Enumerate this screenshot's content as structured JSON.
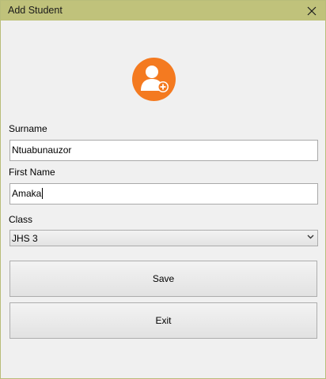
{
  "window": {
    "title": "Add Student",
    "accent_color": "#c0c27b",
    "avatar_color": "#f47a20",
    "avatar_icon": "user-add-icon"
  },
  "form": {
    "surname": {
      "label": "Surname",
      "value": "Ntuabunauzor"
    },
    "first_name": {
      "label": "First Name",
      "value": "Amaka"
    },
    "class": {
      "label": "Class",
      "selected": "JHS 3"
    }
  },
  "buttons": {
    "save_label": "Save",
    "exit_label": "Exit"
  }
}
